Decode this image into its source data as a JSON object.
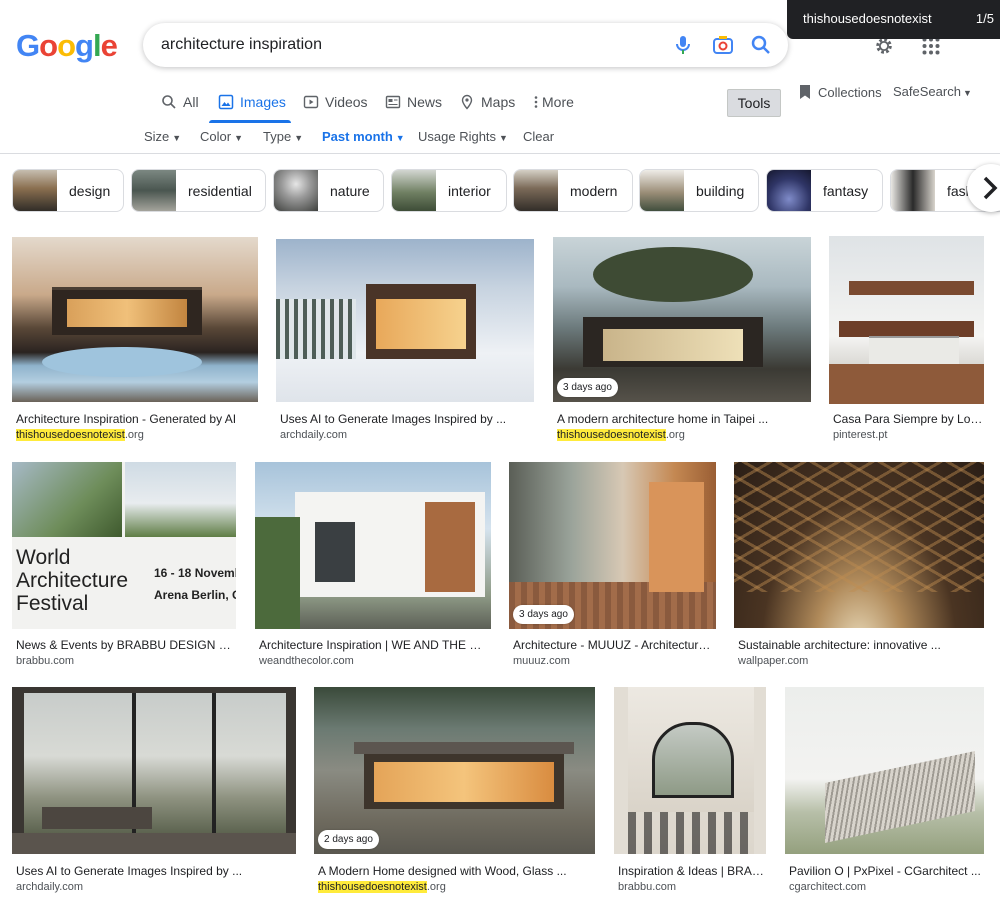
{
  "notice": {
    "text": "thishousedoesnotexist",
    "count": "1/5"
  },
  "logo": {
    "letters": [
      "G",
      "o",
      "o",
      "g",
      "l",
      "e"
    ],
    "colors": [
      "#4285f4",
      "#ea4335",
      "#fbbc05",
      "#4285f4",
      "#34a853",
      "#ea4335"
    ]
  },
  "search": {
    "query": "architecture inspiration"
  },
  "tabs": [
    {
      "label": "All",
      "icon": "search-icon"
    },
    {
      "label": "Images",
      "icon": "image-icon"
    },
    {
      "label": "Videos",
      "icon": "play-icon"
    },
    {
      "label": "News",
      "icon": "news-icon"
    },
    {
      "label": "Maps",
      "icon": "pin-icon"
    },
    {
      "label": "More",
      "icon": "more-vert-icon"
    }
  ],
  "tools_label": "Tools",
  "collections_label": "Collections",
  "safesearch_label": "SafeSearch",
  "filters": [
    {
      "label": "Size"
    },
    {
      "label": "Color"
    },
    {
      "label": "Type"
    },
    {
      "label": "Past month"
    },
    {
      "label": "Usage Rights"
    },
    {
      "label": "Clear"
    }
  ],
  "chips": [
    "design",
    "residential",
    "nature",
    "interior",
    "modern",
    "building",
    "fantasy",
    "fash"
  ],
  "results": [
    {
      "title": "Architecture Inspiration - Generated by AI",
      "site_hl": "thishousedoesnotexist",
      "site": ".org",
      "badge": ""
    },
    {
      "title": "Uses AI to Generate Images Inspired by ...",
      "site_hl": "",
      "site": "archdaily.com",
      "badge": ""
    },
    {
      "title": "A modern architecture home in Taipei ...",
      "site_hl": "thishousedoesnotexist",
      "site": ".org",
      "badge": "3 days ago"
    },
    {
      "title": "Casa Para Siempre by Lon...",
      "site_hl": "",
      "site": "pinterest.pt",
      "badge": ""
    },
    {
      "title": "News & Events by BRABBU DESIGN FOR...",
      "site_hl": "",
      "site": "brabbu.com",
      "badge": "",
      "img_text": [
        "World",
        "Architecture",
        "Festival",
        "16 - 18 Novemb",
        "Arena Berlin, G"
      ]
    },
    {
      "title": "Architecture Inspiration | WE AND THE COL...",
      "site_hl": "",
      "site": "weandthecolor.com",
      "badge": ""
    },
    {
      "title": "Architecture - MUUUZ - Architecture ...",
      "site_hl": "",
      "site": "muuuz.com",
      "badge": "3 days ago"
    },
    {
      "title": "Sustainable architecture: innovative ...",
      "site_hl": "",
      "site": "wallpaper.com",
      "badge": ""
    },
    {
      "title": "Uses AI to Generate Images Inspired by ...",
      "site_hl": "",
      "site": "archdaily.com",
      "badge": ""
    },
    {
      "title": "A Modern Home designed with Wood, Glass ...",
      "site_hl": "thishousedoesnotexist",
      "site": ".org",
      "badge": "2 days ago"
    },
    {
      "title": "Inspiration & Ideas | BRAB...",
      "site_hl": "",
      "site": "brabbu.com",
      "badge": ""
    },
    {
      "title": "Pavilion O | PxPixel - CGarchitect ...",
      "site_hl": "",
      "site": "cgarchitect.com",
      "badge": ""
    }
  ]
}
